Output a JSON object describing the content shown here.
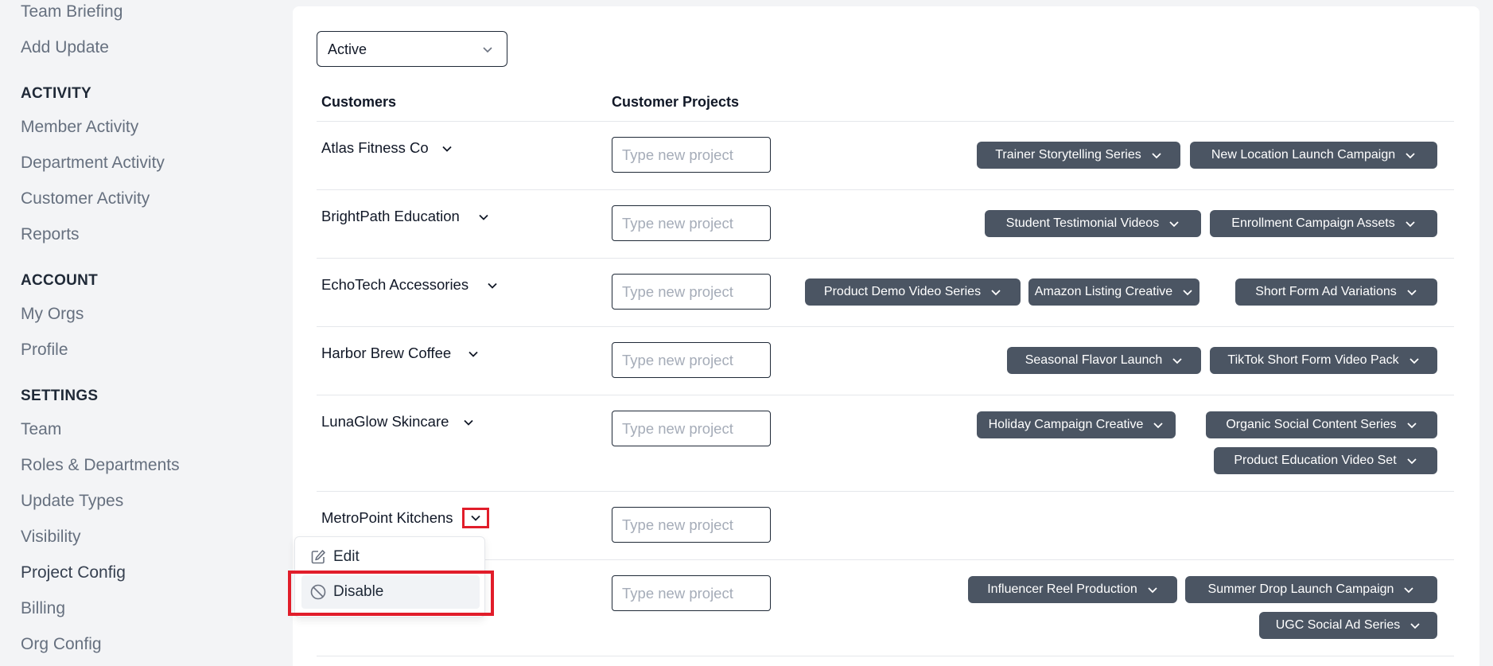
{
  "sidebar": {
    "top_links": [
      "Team Briefing",
      "Add Update"
    ],
    "sections": [
      {
        "heading": "ACTIVITY",
        "items": [
          "Member Activity",
          "Department Activity",
          "Customer Activity",
          "Reports"
        ]
      },
      {
        "heading": "ACCOUNT",
        "items": [
          "My Orgs",
          "Profile"
        ]
      },
      {
        "heading": "SETTINGS",
        "items": [
          "Team",
          "Roles & Departments",
          "Update Types",
          "Visibility",
          "Project Config",
          "Billing",
          "Org Config"
        ]
      }
    ],
    "active_item": "Project Config"
  },
  "filter": {
    "selected": "Active"
  },
  "table": {
    "headers": {
      "customers": "Customers",
      "projects": "Customer Projects"
    },
    "input_placeholder": "Type new project",
    "rows": [
      {
        "customer": "Atlas Fitness Co",
        "projects": [
          "Trainer Storytelling Series",
          "New Location Launch Campaign"
        ]
      },
      {
        "customer": "BrightPath Education",
        "projects": [
          "Student Testimonial Videos",
          "Enrollment Campaign Assets"
        ]
      },
      {
        "customer": "EchoTech Accessories",
        "projects": [
          "Product Demo Video Series",
          "Amazon Listing Creative",
          "Short Form Ad Variations"
        ]
      },
      {
        "customer": "Harbor Brew Coffee",
        "projects": [
          "Seasonal Flavor Launch",
          "TikTok Short Form Video Pack"
        ]
      },
      {
        "customer": "LunaGlow Skincare",
        "projects": [
          "Holiday Campaign Creative",
          "Organic Social Content Series",
          "Product Education Video Set"
        ]
      },
      {
        "customer": "MetroPoint Kitchens",
        "projects": []
      },
      {
        "customer": "",
        "projects": [
          "Influencer Reel Production",
          "Summer Drop Launch Campaign",
          "UGC Social Ad Series"
        ]
      }
    ]
  },
  "customer_menu": {
    "items": [
      {
        "label": "Edit",
        "icon": "edit-icon"
      },
      {
        "label": "Disable",
        "icon": "ban-icon"
      }
    ]
  },
  "colors": {
    "pill_bg": "#4b5563",
    "highlight": "#e11d2a"
  }
}
